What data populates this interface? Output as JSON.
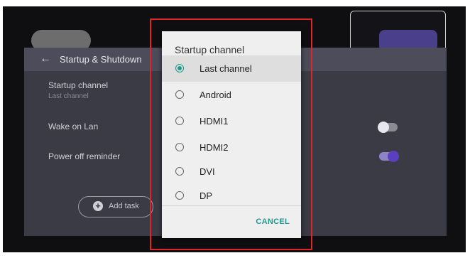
{
  "panel": {
    "title": "Startup & Shutdown",
    "startup_channel": {
      "label": "Startup channel",
      "value": "Last channel"
    },
    "wake_on_lan": {
      "label": "Wake on Lan",
      "enabled": false
    },
    "power_off_reminder": {
      "label": "Power off reminder",
      "enabled": true
    },
    "add_task_label": "Add task"
  },
  "dialog": {
    "title": "Startup channel",
    "options": [
      {
        "label": "Last channel",
        "selected": true
      },
      {
        "label": "Android",
        "selected": false
      },
      {
        "label": "HDMI1",
        "selected": false
      },
      {
        "label": "HDMI2",
        "selected": false
      },
      {
        "label": "DVI",
        "selected": false
      },
      {
        "label": "DP",
        "selected": false
      }
    ],
    "cancel_label": "CANCEL"
  },
  "colors": {
    "accent": "#1e9a8c",
    "toggle_on": "#5c3fbf",
    "highlight_box": "#e0252a"
  }
}
